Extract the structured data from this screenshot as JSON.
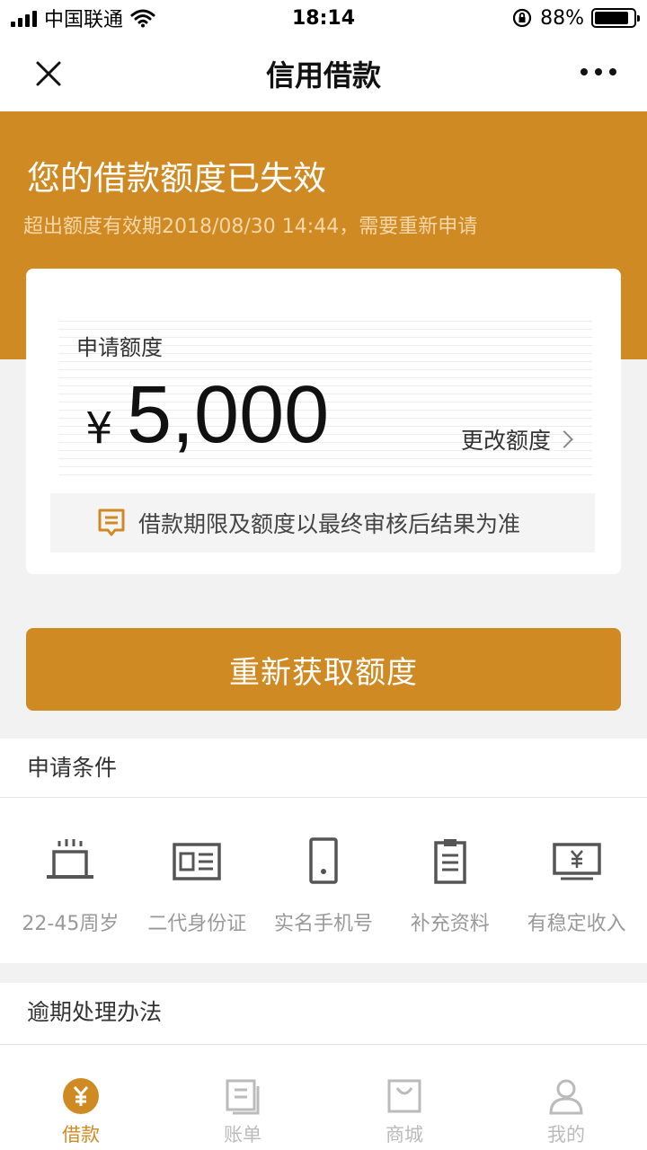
{
  "status_bar": {
    "carrier": "中国联通",
    "time": "18:14",
    "battery": "88%",
    "battery_level": 0.88
  },
  "nav": {
    "title": "信用借款"
  },
  "hero": {
    "title": "您的借款额度已失效",
    "subtitle": "超出额度有效期2018/08/30 14:44，需要重新申请"
  },
  "card": {
    "apply_label": "申请额度",
    "currency": "¥",
    "amount": "5,000",
    "change_label": "更改额度",
    "notice": "借款期限及额度以最终审核后结果为准"
  },
  "action": {
    "label": "重新获取额度"
  },
  "conditions": {
    "title": "申请条件",
    "items": [
      {
        "label": "22-45周岁",
        "icon": "cake-icon"
      },
      {
        "label": "二代身份证",
        "icon": "id-card-icon"
      },
      {
        "label": "实名手机号",
        "icon": "phone-icon"
      },
      {
        "label": "补充资料",
        "icon": "clipboard-icon"
      },
      {
        "label": "有稳定收入",
        "icon": "income-icon"
      }
    ]
  },
  "overdue": {
    "title": "逾期处理办法"
  },
  "tabs": [
    {
      "label": "借款",
      "icon": "loan-icon",
      "active": true
    },
    {
      "label": "账单",
      "icon": "bill-icon",
      "active": false
    },
    {
      "label": "商城",
      "icon": "shop-icon",
      "active": false
    },
    {
      "label": "我的",
      "icon": "profile-icon",
      "active": false
    }
  ],
  "colors": {
    "accent": "#d08a23",
    "inactive": "#bbbbbb"
  }
}
